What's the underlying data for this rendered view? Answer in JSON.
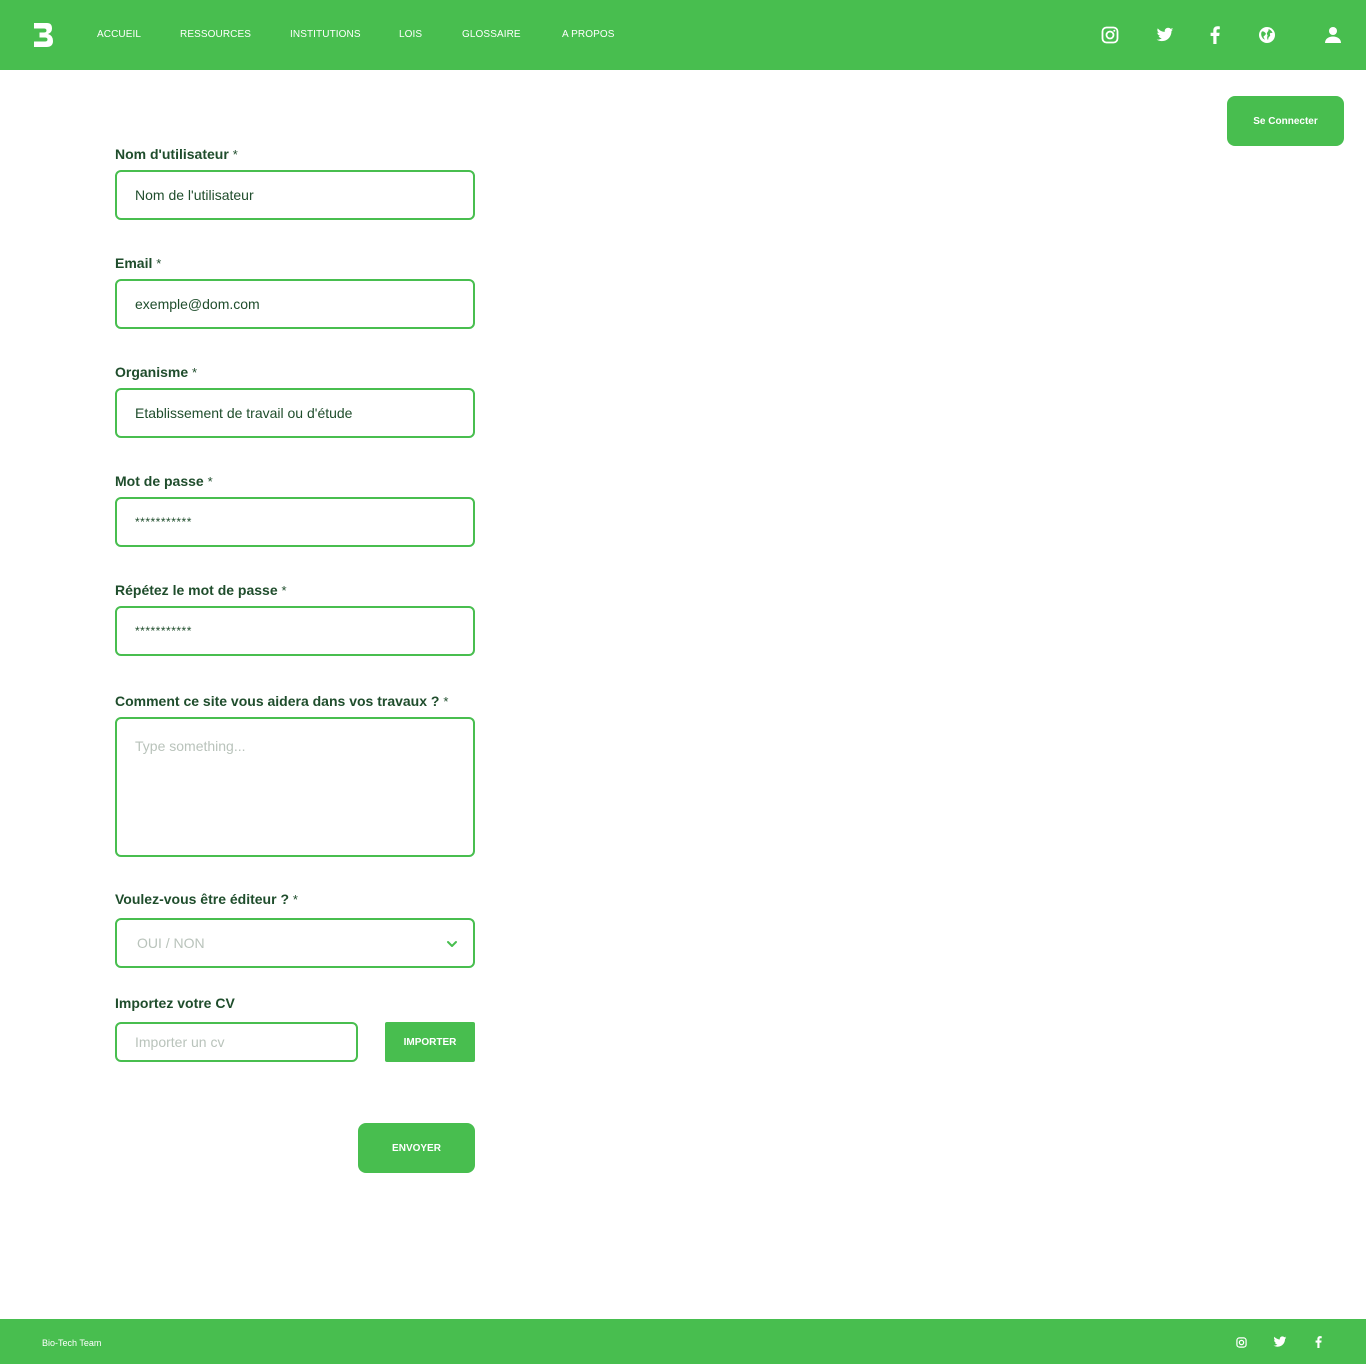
{
  "colors": {
    "brand": "#48be4f",
    "text": "#1f4d2c",
    "placeholder": "#b9c3bb"
  },
  "nav": {
    "items": [
      {
        "label": "ACCUEIL"
      },
      {
        "label": "RESSOURCES"
      },
      {
        "label": "INSTITUTIONS"
      },
      {
        "label": "LOIS"
      },
      {
        "label": "GLOSSAIRE"
      },
      {
        "label": "A PROPOS"
      }
    ],
    "icons": [
      "instagram-icon",
      "twitter-icon",
      "facebook-icon",
      "globe-icon",
      "user-icon"
    ]
  },
  "connect": {
    "label": "Se Connecter"
  },
  "form": {
    "required_mark": "*",
    "username": {
      "label": "Nom d'utilisateur",
      "value": "Nom de l'utilisateur"
    },
    "email": {
      "label": "Email",
      "value": "exemple@dom.com"
    },
    "organisme": {
      "label": "Organisme",
      "value": "Etablissement de travail ou d'étude"
    },
    "password": {
      "label": "Mot de passe",
      "value": "***********"
    },
    "password_repeat": {
      "label": "Répétez le mot de passe",
      "value": "***********"
    },
    "motivation": {
      "label": "Comment ce site vous aidera dans vos travaux ?",
      "placeholder": "Type something..."
    },
    "editor": {
      "label": "Voulez-vous être éditeur ?",
      "placeholder": "OUI / NON"
    },
    "cv": {
      "label": "Importez votre CV",
      "placeholder": "Importer un cv",
      "button": "IMPORTER"
    },
    "submit": {
      "label": "ENVOYER"
    }
  },
  "footer": {
    "text": "Bio-Tech Team",
    "icons": [
      "instagram-icon",
      "bird-icon",
      "facebook-icon"
    ]
  }
}
